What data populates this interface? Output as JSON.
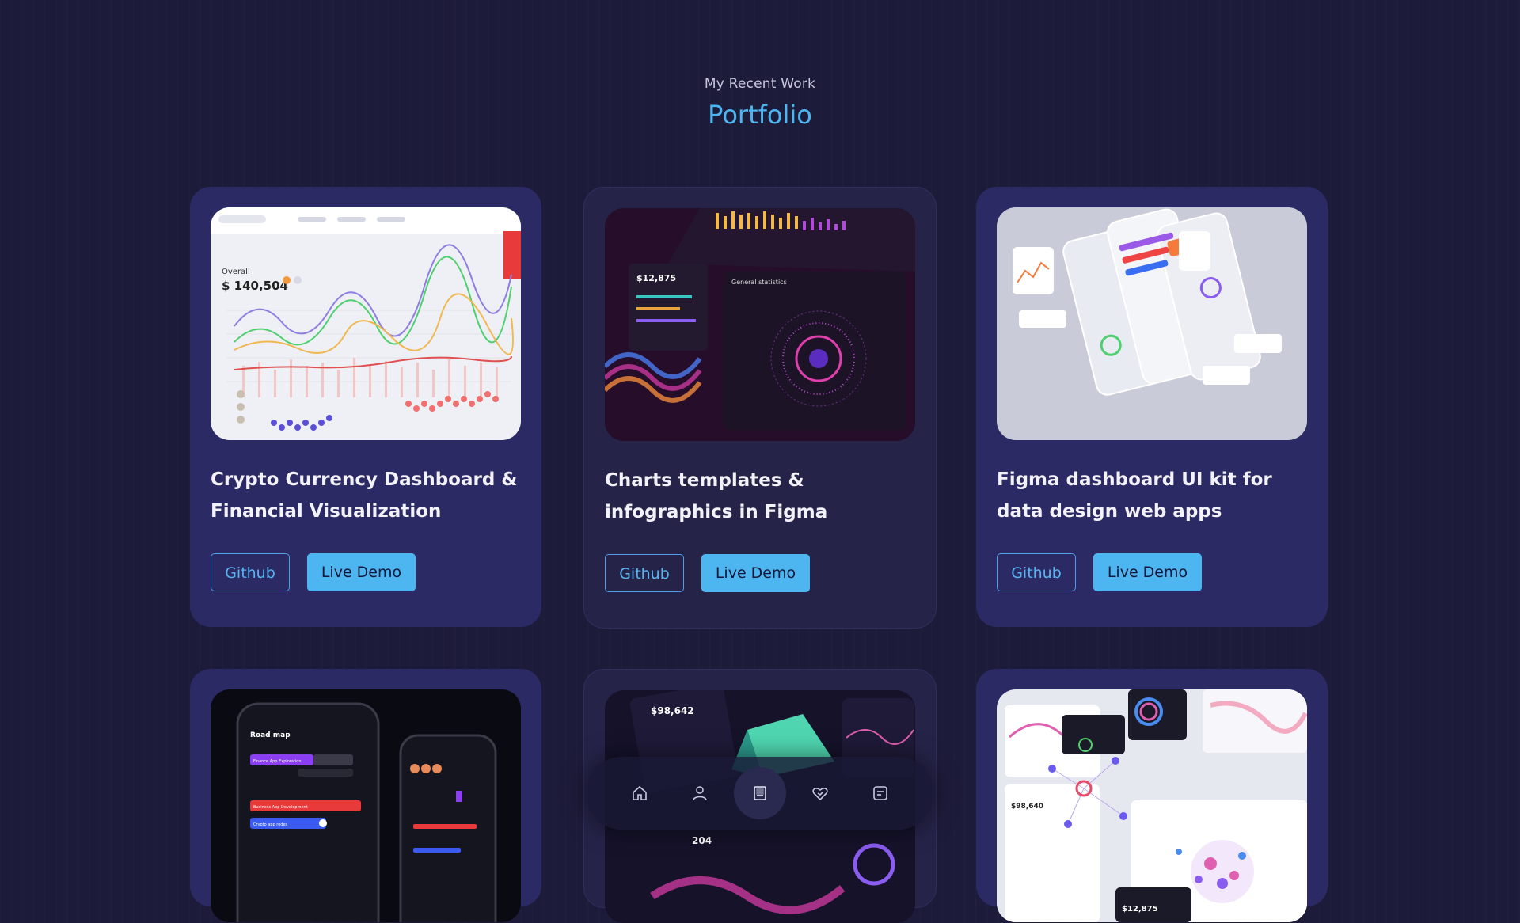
{
  "header": {
    "subtitle": "My Recent Work",
    "title": "Portfolio"
  },
  "projects": [
    {
      "title": "Crypto Currency Dashboard & Financial Visualization",
      "github_label": "Github",
      "demo_label": "Live Demo"
    },
    {
      "title": "Charts templates & infographics in Figma",
      "github_label": "Github",
      "demo_label": "Live Demo"
    },
    {
      "title": "Figma dashboard UI kit for data design web apps",
      "github_label": "Github",
      "demo_label": "Live Demo"
    },
    {
      "title": "",
      "github_label": "",
      "demo_label": ""
    },
    {
      "title": "",
      "github_label": "",
      "demo_label": ""
    },
    {
      "title": "",
      "github_label": "",
      "demo_label": ""
    }
  ],
  "thumb_text": {
    "crypto_amount": "$ 140,504",
    "crypto_label": "Overall",
    "charts_amount": "$12,875",
    "charts_label": "General statistics",
    "roadmap_title": "Road map",
    "roadmap_item1": "Finance App Exploration",
    "roadmap_item2": "Business App Development",
    "roadmap_item3": "Crypto app redes",
    "dark_amount": "$98,642",
    "dark_amount2": "204",
    "light_amount": "$98,640",
    "light_amount2": "$12,875"
  },
  "bottom_nav": {
    "items": [
      {
        "icon": "home-icon"
      },
      {
        "icon": "user-icon"
      },
      {
        "icon": "portfolio-icon",
        "active": true
      },
      {
        "icon": "services-icon"
      },
      {
        "icon": "contact-icon"
      }
    ]
  },
  "colors": {
    "accent": "#4db5f0",
    "card_bg": "#2c2a64",
    "page_bg": "#1d1b3a"
  }
}
